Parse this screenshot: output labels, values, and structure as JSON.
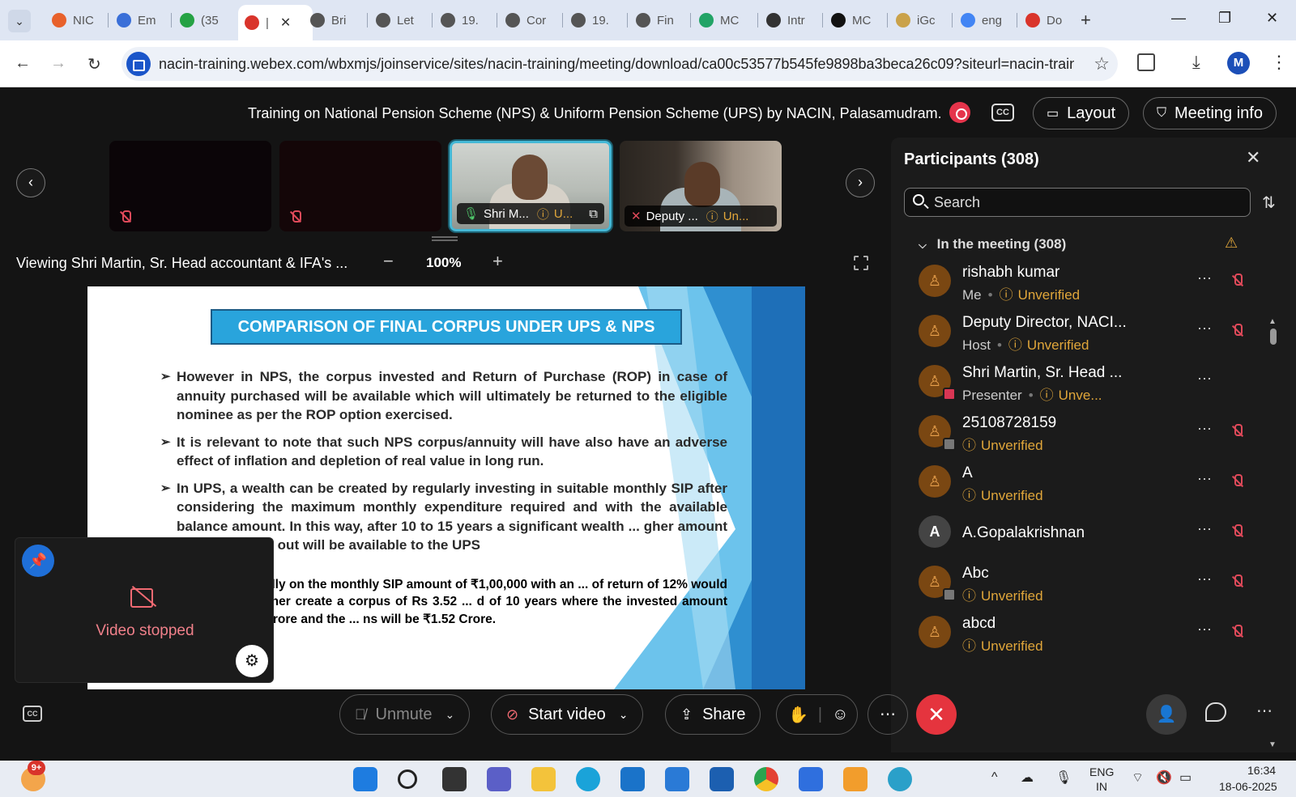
{
  "browser": {
    "tabs": [
      {
        "label": "NIC",
        "color": "#e8612b"
      },
      {
        "label": "Em",
        "color": "#3a6fd8"
      },
      {
        "label": "(35",
        "color": "#25a244"
      },
      {
        "label": "|",
        "color": "#d9342b"
      },
      {
        "label": "Bri",
        "color": "#555555"
      },
      {
        "label": "Let",
        "color": "#555555"
      },
      {
        "label": "19.",
        "color": "#555555"
      },
      {
        "label": "Cor",
        "color": "#555555"
      },
      {
        "label": "19.",
        "color": "#555555"
      },
      {
        "label": "Fin",
        "color": "#555555"
      },
      {
        "label": "MC",
        "color": "#21a366"
      },
      {
        "label": "Intr",
        "color": "#333333"
      },
      {
        "label": "MC",
        "color": "#111111"
      },
      {
        "label": "iGc",
        "color": "#caa24a"
      },
      {
        "label": "eng",
        "color": "#4285f4"
      },
      {
        "label": "Do",
        "color": "#d9342b"
      }
    ],
    "url": "nacin-training.webex.com/wbxmjs/joinservice/sites/nacin-training/meeting/download/ca00c53577b545fe9898ba3beca26c09?siteurl=nacin-traini...",
    "profile_initial": "M"
  },
  "meeting": {
    "title": "Training on National Pension Scheme (NPS) & Uniform Pension Scheme (UPS) by NACIN, Palasamudram.",
    "cc_label": "CC",
    "layout_label": "Layout",
    "info_label": "Meeting info",
    "thumbnails": [
      {
        "name": "",
        "status": ""
      },
      {
        "name": "",
        "status": ""
      },
      {
        "name": "Shri M...",
        "status": "U..."
      },
      {
        "name": "Deputy ...",
        "status": "Un..."
      }
    ],
    "viewing": "Viewing Shri Martin, Sr. Head accountant & IFA's ...",
    "zoom": "100%"
  },
  "slide": {
    "title": "COMPARISON OF FINAL CORPUS UNDER UPS & NPS",
    "bullets": [
      "However in NPS, the corpus invested and Return of Purchase (ROP) in case of annuity purchased will be available which will ultimately be returned to the eligible nominee as per the ROP option exercised.",
      "It is relevant to note that such NPS corpus/annuity will have also have an adverse effect of inflation and depletion of real value  in long run.",
      "In UPS, a wealth can be created by regularly investing in suitable monthly SIP after considering the maximum monthly expenditure required and with the available balance amount.  In this way, after 10 to 15 years a significant wealth ... gher amount of pension pay out will be available to the UPS"
    ],
    "note": "... of 10% annually on the monthly SIP amount of ₹1,00,000  with an ... of return of 12% would help the pensioner create a corpus of Rs 3.52 ... d of 10 years where the invested amount will be Rs 1.99 crore and the ... ns will be  ₹1.52 Crore."
  },
  "selfview": {
    "status": "Video stopped"
  },
  "participants": {
    "title": "Participants (308)",
    "search_placeholder": "Search",
    "section": "In the meeting (308)",
    "list": [
      {
        "name": "rishabh kumar",
        "role": "Me",
        "status": "Unverified",
        "avatar": "person",
        "badge": "",
        "muted": true
      },
      {
        "name": "Deputy Director, NACI...",
        "role": "Host",
        "status": "Unverified",
        "avatar": "person",
        "badge": "",
        "muted": true
      },
      {
        "name": "Shri Martin, Sr. Head ...",
        "role": "Presenter",
        "status": "Unve...",
        "avatar": "person",
        "badge": "share",
        "muted": false
      },
      {
        "name": "25108728159",
        "role": "",
        "status": "Unverified",
        "avatar": "person",
        "badge": "phone",
        "muted": true
      },
      {
        "name": "A",
        "role": "",
        "status": "Unverified",
        "avatar": "person",
        "badge": "",
        "muted": true
      },
      {
        "name": "A.Gopalakrishnan",
        "role": "",
        "status": "",
        "avatar": "A",
        "badge": "",
        "muted": true
      },
      {
        "name": "Abc",
        "role": "",
        "status": "Unverified",
        "avatar": "person",
        "badge": "phone",
        "muted": true
      },
      {
        "name": "abcd",
        "role": "",
        "status": "Unverified",
        "avatar": "person",
        "badge": "",
        "muted": true
      }
    ]
  },
  "controls": {
    "unmute": "Unmute",
    "start_video": "Start video",
    "share": "Share"
  },
  "taskbar": {
    "notif_count": "9+",
    "lang_top": "ENG",
    "lang_bottom": "IN",
    "time": "16:34",
    "date": "18-06-2025"
  }
}
